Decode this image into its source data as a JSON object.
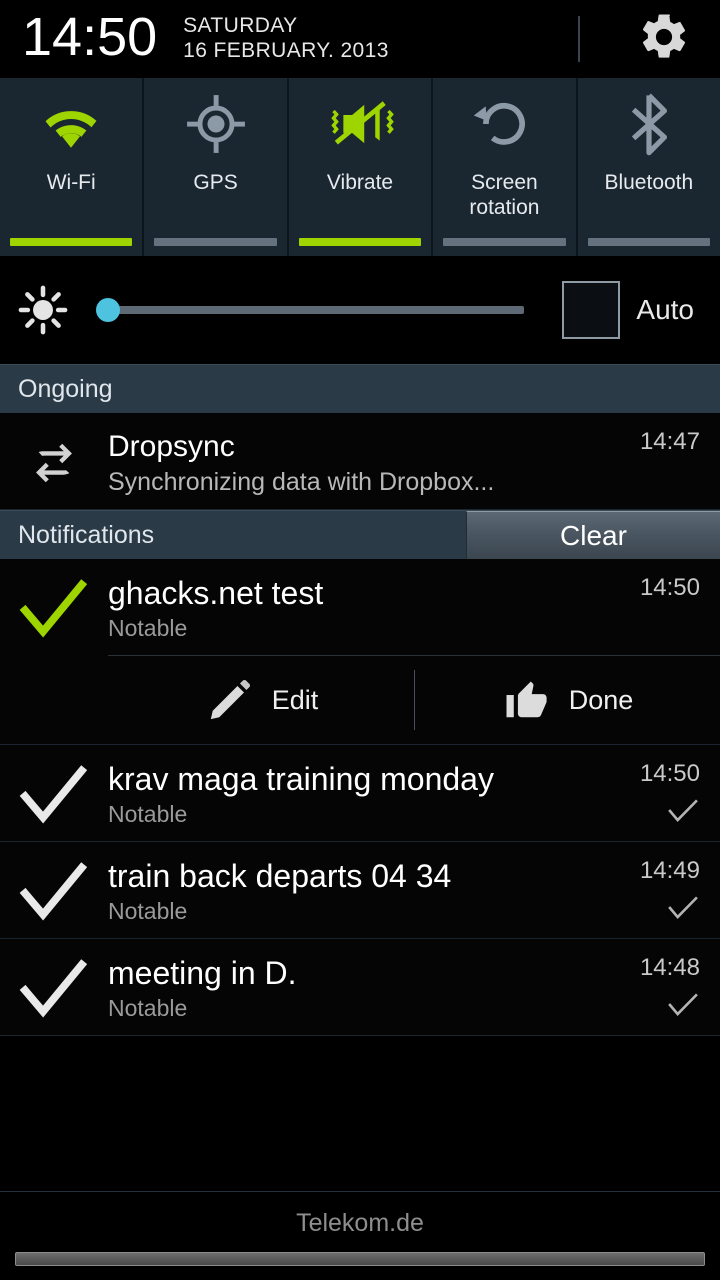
{
  "header": {
    "clock": "14:50",
    "day": "SATURDAY",
    "date": "16 FEBRUARY. 2013",
    "settings_icon": "gear-icon"
  },
  "quick_settings": {
    "accent_on": "#9ed400",
    "accent_off": "#64727f",
    "panel_bg": "#1a2731",
    "toggles": [
      {
        "label": "Wi-Fi",
        "icon": "wifi-icon",
        "state": "on"
      },
      {
        "label": "GPS",
        "icon": "gps-icon",
        "state": "off"
      },
      {
        "label": "Vibrate",
        "icon": "vibrate-icon",
        "state": "on"
      },
      {
        "label": "Screen\nrotation",
        "label_line1": "Screen",
        "label_line2": "rotation",
        "icon": "screen-rotation-icon",
        "state": "off"
      },
      {
        "label": "Bluetooth",
        "icon": "bluetooth-icon",
        "state": "off"
      }
    ]
  },
  "brightness": {
    "icon": "brightness-icon",
    "value_percent": 2,
    "thumb_color": "#4ec3e0",
    "auto_label": "Auto",
    "auto_checked": false
  },
  "sections": {
    "ongoing": {
      "title": "Ongoing",
      "header_bg": "#2b3a47"
    },
    "notifications": {
      "title": "Notifications",
      "clear_label": "Clear"
    }
  },
  "ongoing_items": [
    {
      "icon": "sync-icon",
      "title": "Dropsync",
      "subtitle": "Synchronizing data with Dropbox...",
      "time": "14:47"
    }
  ],
  "notifications": [
    {
      "icon": "checkmark-icon",
      "icon_color": "#9ed400",
      "title": "ghacks.net test",
      "subtitle": "Notable",
      "time": "14:50",
      "has_right_check": false,
      "actions": [
        {
          "icon": "pencil-icon",
          "label": "Edit"
        },
        {
          "icon": "thumbs-up-icon",
          "label": "Done"
        }
      ]
    },
    {
      "icon": "checkmark-icon",
      "icon_color": "#e9e9e9",
      "title": "krav maga training monday",
      "subtitle": "Notable",
      "time": "14:50",
      "has_right_check": true,
      "actions": []
    },
    {
      "icon": "checkmark-icon",
      "icon_color": "#e9e9e9",
      "title": "train back departs 04 34",
      "subtitle": "Notable",
      "time": "14:49",
      "has_right_check": true,
      "actions": []
    },
    {
      "icon": "checkmark-icon",
      "icon_color": "#e9e9e9",
      "title": "meeting in D.",
      "subtitle": "Notable",
      "time": "14:48",
      "has_right_check": true,
      "actions": []
    }
  ],
  "footer": {
    "carrier": "Telekom.de",
    "handle": "drag-handle"
  }
}
